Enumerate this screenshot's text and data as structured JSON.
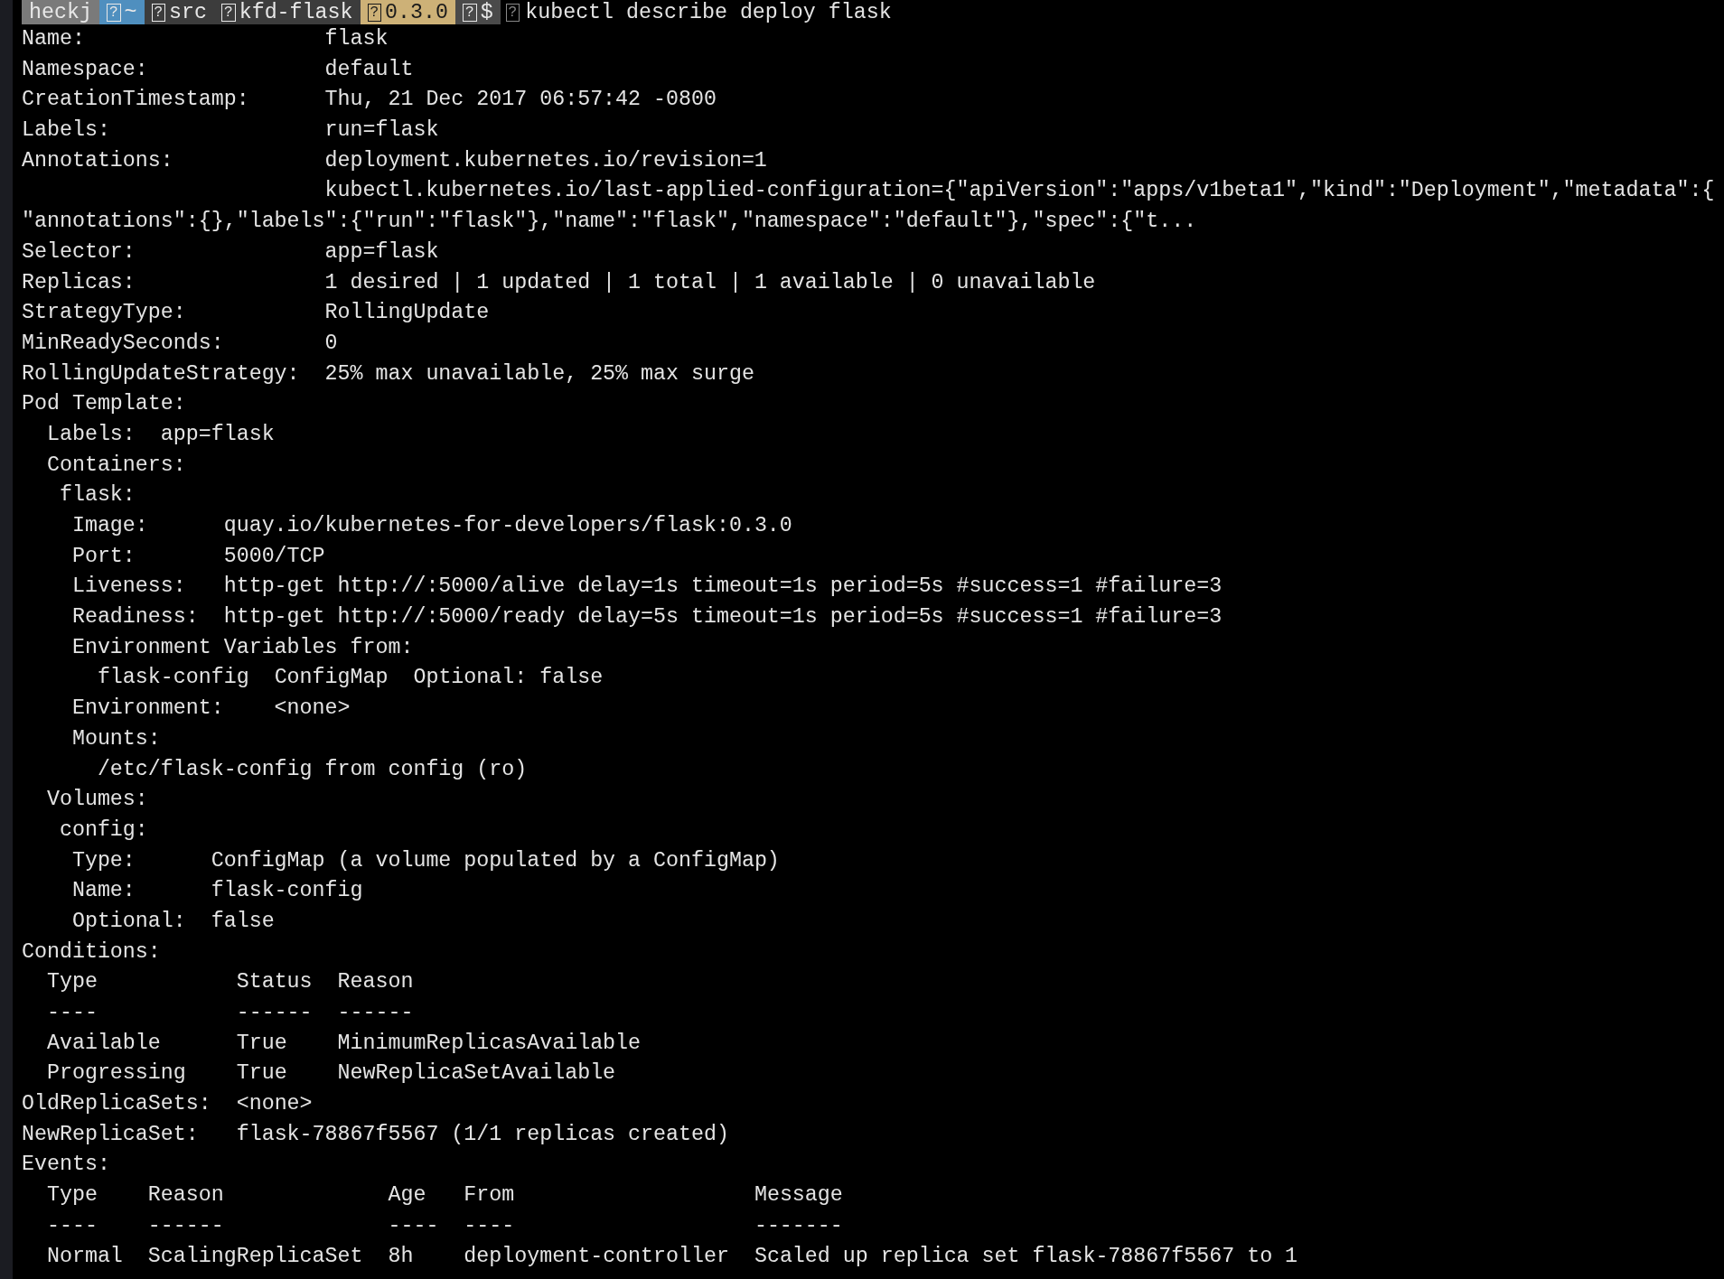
{
  "prompt": {
    "segments": [
      {
        "text": "heckj",
        "color": "#7a7a7a"
      },
      {
        "icon": "?",
        "text": "~",
        "color": "#4f8fbf"
      },
      {
        "icon": "?",
        "text": "src",
        "color": "#3c3c3c"
      },
      {
        "icon": "?",
        "text": "kfd-flask",
        "color": "#3c3c3c"
      },
      {
        "icon": "?",
        "text": "0.3.0",
        "color": "#cdb177"
      },
      {
        "icon": "?",
        "text": "$",
        "color": "#4a4a4a"
      }
    ],
    "command_icon": "?",
    "command": "kubectl describe deploy flask"
  },
  "output_lines": [
    "Name:                   flask",
    "Namespace:              default",
    "CreationTimestamp:      Thu, 21 Dec 2017 06:57:42 -0800",
    "Labels:                 run=flask",
    "Annotations:            deployment.kubernetes.io/revision=1",
    "                        kubectl.kubernetes.io/last-applied-configuration={\"apiVersion\":\"apps/v1beta1\",\"kind\":\"Deployment\",\"metadata\":{",
    "\"annotations\":{},\"labels\":{\"run\":\"flask\"},\"name\":\"flask\",\"namespace\":\"default\"},\"spec\":{\"t...",
    "Selector:               app=flask",
    "Replicas:               1 desired | 1 updated | 1 total | 1 available | 0 unavailable",
    "StrategyType:           RollingUpdate",
    "MinReadySeconds:        0",
    "RollingUpdateStrategy:  25% max unavailable, 25% max surge",
    "Pod Template:",
    "  Labels:  app=flask",
    "  Containers:",
    "   flask:",
    "    Image:      quay.io/kubernetes-for-developers/flask:0.3.0",
    "    Port:       5000/TCP",
    "    Liveness:   http-get http://:5000/alive delay=1s timeout=1s period=5s #success=1 #failure=3",
    "    Readiness:  http-get http://:5000/ready delay=5s timeout=1s period=5s #success=1 #failure=3",
    "    Environment Variables from:",
    "      flask-config  ConfigMap  Optional: false",
    "    Environment:    <none>",
    "    Mounts:",
    "      /etc/flask-config from config (ro)",
    "  Volumes:",
    "   config:",
    "    Type:      ConfigMap (a volume populated by a ConfigMap)",
    "    Name:      flask-config",
    "    Optional:  false",
    "Conditions:",
    "  Type           Status  Reason",
    "  ----           ------  ------",
    "  Available      True    MinimumReplicasAvailable",
    "  Progressing    True    NewReplicaSetAvailable",
    "OldReplicaSets:  <none>",
    "NewReplicaSet:   flask-78867f5567 (1/1 replicas created)",
    "Events:",
    "  Type    Reason             Age   From                   Message",
    "  ----    ------             ----  ----                   -------",
    "  Normal  ScalingReplicaSet  8h    deployment-controller  Scaled up replica set flask-78867f5567 to 1"
  ]
}
